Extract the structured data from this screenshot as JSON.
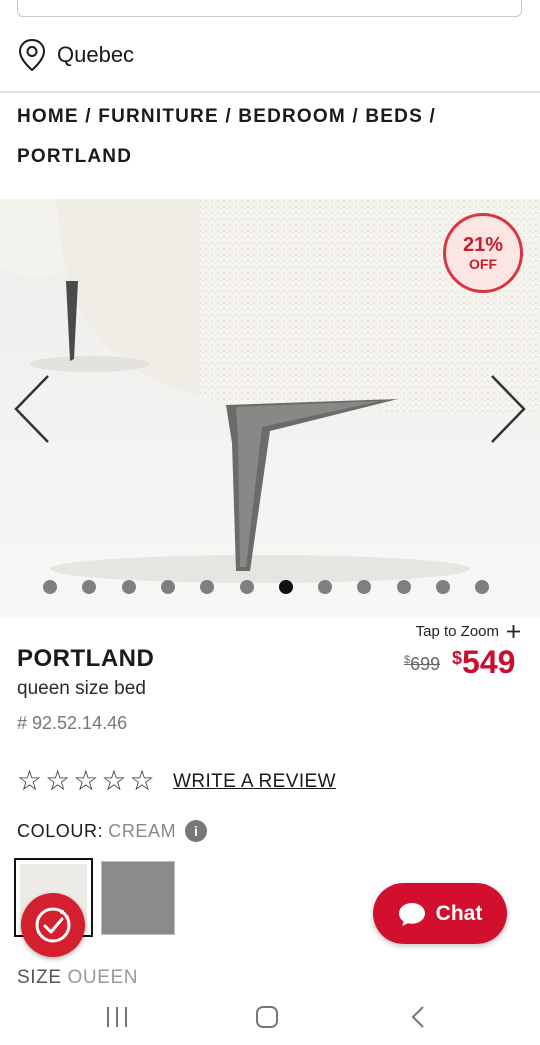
{
  "header": {
    "location": "Quebec"
  },
  "breadcrumb": {
    "items": [
      "HOME",
      "FURNITURE",
      "BEDROOM",
      "BEDS",
      "PORTLAND"
    ],
    "separator": "/"
  },
  "gallery": {
    "badge_percent": "21%",
    "badge_off": "OFF",
    "slide_count": 12,
    "active_slide": 7
  },
  "product": {
    "tap_to_zoom": "Tap to Zoom",
    "title": "PORTLAND",
    "subtitle": "queen size bed",
    "sku": "# 92.52.14.46",
    "old_price_symbol": "$",
    "old_price": "699",
    "new_price_symbol": "$",
    "new_price": "549",
    "rating_stars": 5,
    "rating_value": 0,
    "review_link": "WRITE A REVIEW",
    "colour_label": "COLOUR:",
    "colour_value": "CREAM",
    "swatches": [
      "cream",
      "grey"
    ],
    "size_label": "SIZE",
    "size_value": "QUEEN"
  },
  "chat": {
    "label": "Chat"
  },
  "colors": {
    "brand_red": "#d20f2c",
    "price_red": "#c8102e",
    "swatch_cream": "#ecebe7",
    "swatch_grey": "#8d8a8d"
  }
}
